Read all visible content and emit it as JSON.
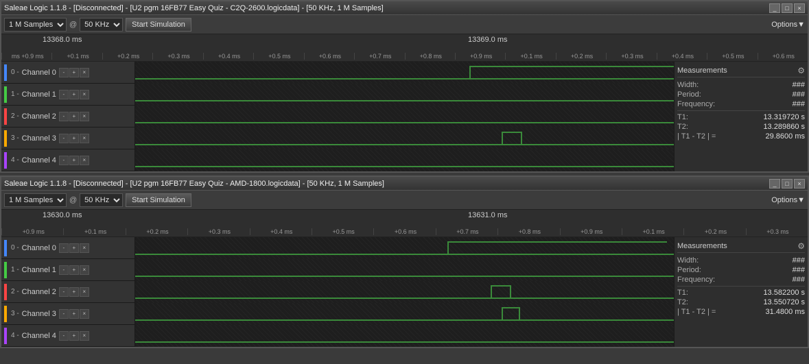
{
  "window1": {
    "title": "Saleae Logic 1.1.8 - [Disconnected] - [U2 pgm 16FB77 Easy Quiz - C2Q-2600.logicdata] - [50 KHz, 1 M Samples]",
    "toolbar": {
      "samples": "1 M Samples",
      "freq": "50 KHz",
      "sim_button": "Start Simulation",
      "options_button": "Options▼"
    },
    "timeline": {
      "time_left": "13368.0 ms",
      "time_right": "13369.0 ms",
      "ticks_left": [
        "+0.9 ms",
        "+0.1 ms",
        "+0.2 ms",
        "+0.3 ms",
        "+0.4 ms",
        "+0.5 ms",
        "+0.6 ms",
        "+0.7 ms",
        "+0.8 ms",
        "+0.9 ms"
      ],
      "ticks_right": [
        "+0.1 ms",
        "+0.2 ms",
        "+0.3 ms",
        "+0.4 ms",
        "+0.5 ms",
        "+0.6 ms"
      ]
    },
    "channels": [
      {
        "id": "0",
        "name": "Channel 0",
        "color": "ch0-color"
      },
      {
        "id": "1",
        "name": "Channel 1",
        "color": "ch1-color"
      },
      {
        "id": "2",
        "name": "Channel 2",
        "color": "ch2-color"
      },
      {
        "id": "3",
        "name": "Channel 3",
        "color": "ch3-color"
      },
      {
        "id": "4",
        "name": "Channel 4",
        "color": "ch4-color"
      }
    ],
    "measurements": {
      "title": "Measurements",
      "width_label": "Width:",
      "width_value": "###",
      "period_label": "Period:",
      "period_value": "###",
      "freq_label": "Frequency:",
      "freq_value": "###",
      "t1_label": "T1:",
      "t1_value": "13.319720 s",
      "t2_label": "T2:",
      "t2_value": "13.289860 s",
      "diff_label": "| T1 - T2 | =",
      "diff_value": "29.8600 ms"
    }
  },
  "window2": {
    "title": "Saleae Logic 1.1.8 - [Disconnected] - [U2 pgm 16FB77 Easy Quiz - AMD-1800.logicdata] - [50 KHz, 1 M Samples]",
    "toolbar": {
      "samples": "1 M Samples",
      "freq": "50 KHz",
      "sim_button": "Start Simulation",
      "options_button": "Options▼"
    },
    "timeline": {
      "time_left": "13630.0 ms",
      "time_right": "13631.0 ms",
      "ticks_left": [
        "+0.9 ms",
        "+0.1 ms",
        "+0.2 ms",
        "+0.3 ms",
        "+0.4 ms",
        "+0.5 ms",
        "+0.6 ms",
        "+0.7 ms",
        "+0.8 ms",
        "+0.9 ms"
      ],
      "ticks_right": [
        "+0.1 ms",
        "+0.2 ms",
        "+0.3 ms"
      ]
    },
    "channels": [
      {
        "id": "0",
        "name": "Channel 0",
        "color": "ch0-color"
      },
      {
        "id": "1",
        "name": "Channel 1",
        "color": "ch1-color"
      },
      {
        "id": "2",
        "name": "Channel 2",
        "color": "ch2-color"
      },
      {
        "id": "3",
        "name": "Channel 3",
        "color": "ch3-color"
      },
      {
        "id": "4",
        "name": "Channel 4",
        "color": "ch4-color"
      }
    ],
    "measurements": {
      "title": "Measurements",
      "width_label": "Width:",
      "width_value": "###",
      "period_label": "Period:",
      "period_value": "###",
      "freq_label": "Frequency:",
      "freq_value": "###",
      "t1_label": "T1:",
      "t1_value": "13.582200 s",
      "t2_label": "T2:",
      "t2_value": "13.550720 s",
      "diff_label": "| T1 - T2 | =",
      "diff_value": "31.4800 ms"
    }
  }
}
